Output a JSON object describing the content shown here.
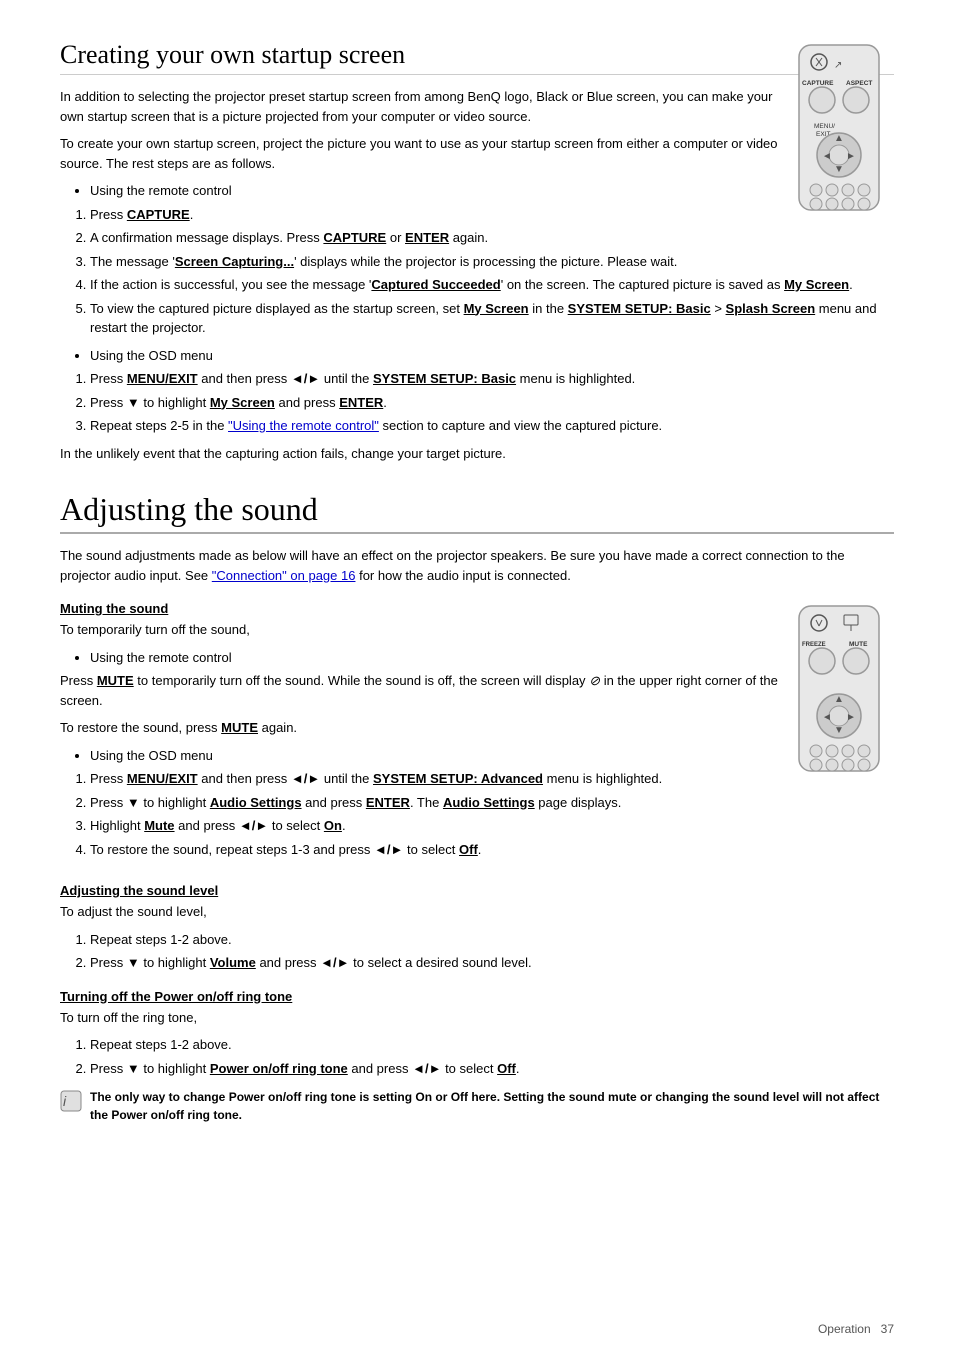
{
  "page": {
    "section1": {
      "title": "Creating your own startup screen",
      "intro1": "In addition to selecting the projector preset startup screen from among BenQ logo, Black or Blue screen, you can make your own startup screen that is a picture projected from your computer or video source.",
      "intro2": "To create your own startup screen, project the picture you want to use as your startup screen from either a computer or video source. The rest steps are as follows.",
      "remote_bullet": "Using the remote control",
      "remote_steps": [
        "Press CAPTURE.",
        "A confirmation message displays. Press CAPTURE or ENTER again.",
        "The message 'Screen Capturing...' displays while the projector is processing the picture. Please wait.",
        "If the action is successful, you see the message 'Captured Succeeded' on the screen. The captured picture is saved as My Screen.",
        "To view the captured picture displayed as the startup screen, set My Screen in the SYSTEM SETUP: Basic > Splash Screen menu and restart the projector."
      ],
      "osd_bullet": "Using the OSD menu",
      "osd_steps": [
        "Press MENU/EXIT and then press ◄/► until the SYSTEM SETUP: Basic menu is highlighted.",
        "Press ▼ to highlight My Screen and press ENTER.",
        "Repeat steps 2-5 in the \"Using the remote control\" section to capture and view the captured picture."
      ],
      "osd_note": "In the unlikely event that the capturing action fails, change your target picture."
    },
    "section2": {
      "title": "Adjusting the sound",
      "intro1": "The sound adjustments made as below will have an effect on the projector speakers. Be sure you have made a correct connection to the projector audio input. See ",
      "intro1_link": "\"Connection\" on page 16",
      "intro1_end": " for how the audio input is connected.",
      "subsection1": {
        "title": "Muting the sound",
        "intro": "To temporarily turn off the sound,",
        "remote_bullet": "Using the remote control",
        "remote_text1": "Press MUTE to temporarily turn off the sound. While the sound is off, the screen will display ",
        "remote_text2": " in the upper right corner of the screen.",
        "remote_text3": "To restore the sound, press MUTE again.",
        "osd_bullet": "Using the OSD menu",
        "osd_steps": [
          "Press MENU/EXIT and then press ◄/► until the SYSTEM SETUP: Advanced menu is highlighted.",
          "Press ▼ to highlight Audio Settings and press ENTER. The Audio Settings page displays.",
          "Highlight Mute and press ◄/► to select On.",
          "To restore the sound, repeat steps 1-3 and press ◄/► to select Off."
        ]
      },
      "subsection2": {
        "title": "Adjusting the sound level",
        "intro": "To adjust the sound level,",
        "steps": [
          "Repeat steps 1-2 above.",
          "Press ▼ to highlight Volume and press ◄/► to select a desired sound level."
        ]
      },
      "subsection3": {
        "title": "Turning off the Power on/off ring tone",
        "intro": "To turn off the ring tone,",
        "steps": [
          "Repeat steps 1-2 above.",
          "Press ▼ to highlight Power on/off ring tone and press ◄/► to select Off."
        ]
      },
      "note": "The only way to change Power on/off ring tone is setting On or Off here. Setting the sound mute or changing the sound level will not affect the Power on/off ring tone."
    },
    "footer": {
      "label": "Operation",
      "page_number": "37"
    }
  }
}
